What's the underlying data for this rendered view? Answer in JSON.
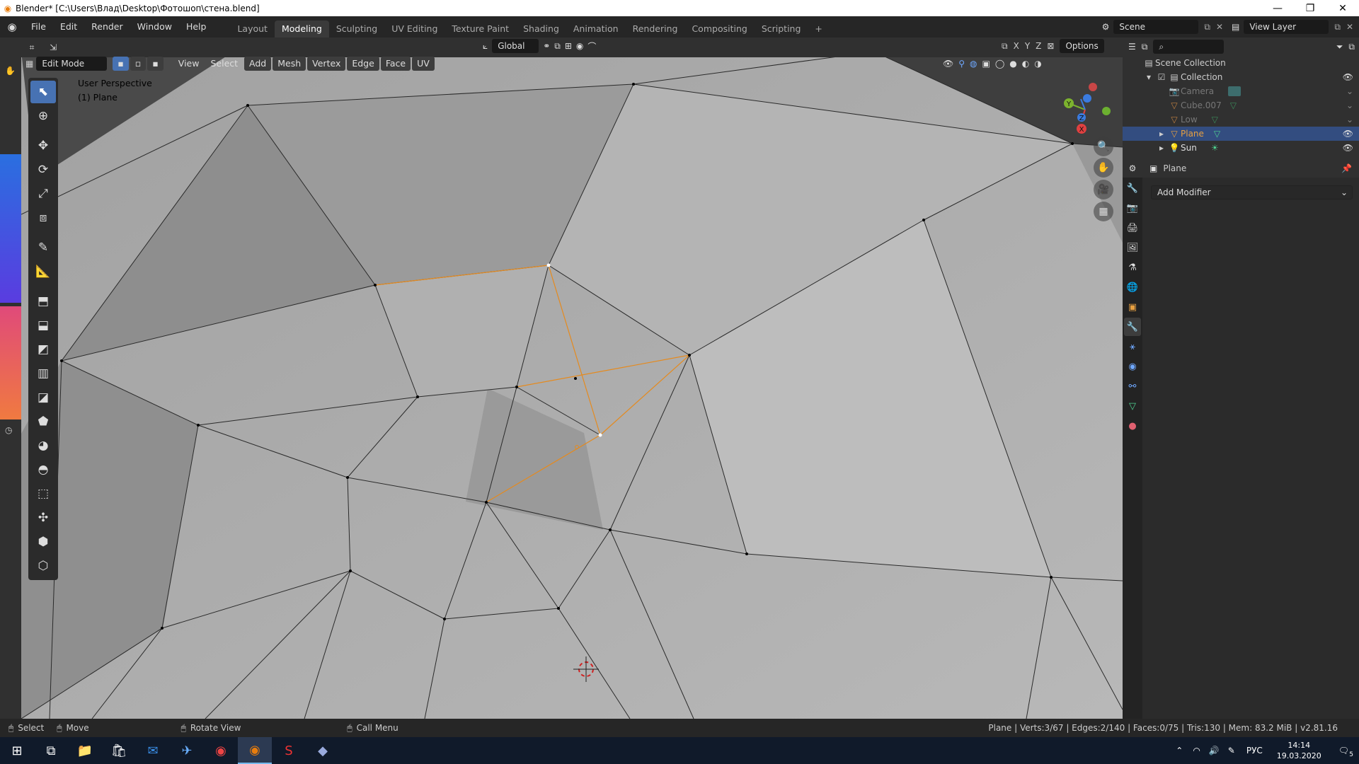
{
  "window": {
    "title": "Blender* [C:\\Users\\Влад\\Desktop\\Фотошоп\\стена.blend]",
    "minimize": "—",
    "restore": "❐",
    "close": "✕"
  },
  "topbar": {
    "menus": [
      "File",
      "Edit",
      "Render",
      "Window",
      "Help"
    ],
    "workspaces": [
      "Layout",
      "Modeling",
      "Sculpting",
      "UV Editing",
      "Texture Paint",
      "Shading",
      "Animation",
      "Rendering",
      "Compositing",
      "Scripting"
    ],
    "active_workspace": "Modeling",
    "add_workspace": "+",
    "scene_value": "Scene",
    "view_layer_value": "View Layer"
  },
  "viewport_header": {
    "mode": "Edit Mode",
    "menus": [
      "View",
      "Select",
      "Add",
      "Mesh",
      "Vertex",
      "Edge",
      "Face",
      "UV"
    ],
    "orientation": "Global",
    "axes": [
      "X",
      "Y",
      "Z"
    ],
    "options": "Options"
  },
  "viewport": {
    "perspective_label": "User Perspective",
    "object_label": "(1) Plane",
    "background_color": "#a9a9a9",
    "selected_edge_color": "#e58a1e"
  },
  "gizmo": {
    "x": "X",
    "y": "Y",
    "z": "Z"
  },
  "outliner": {
    "root": "Scene Collection",
    "collection": "Collection",
    "items": [
      {
        "name": "Camera",
        "state": "dim"
      },
      {
        "name": "Cube.007",
        "state": "dim"
      },
      {
        "name": "Low",
        "state": "dim"
      },
      {
        "name": "Plane",
        "state": "selected"
      },
      {
        "name": "Sun",
        "state": "normal"
      }
    ]
  },
  "properties": {
    "object_name": "Plane",
    "add_modifier": "Add Modifier"
  },
  "statusbar": {
    "select": "Select",
    "move": "Move",
    "rotate": "Rotate View",
    "call_menu": "Call Menu",
    "stats": "Plane | Verts:3/67 | Edges:2/140 | Faces:0/75 | Tris:130 | Mem: 83.2 MiB | v2.81.16"
  },
  "taskbar": {
    "lang": "РУС",
    "time": "14:14",
    "date": "19.03.2020",
    "notifications": "5"
  }
}
